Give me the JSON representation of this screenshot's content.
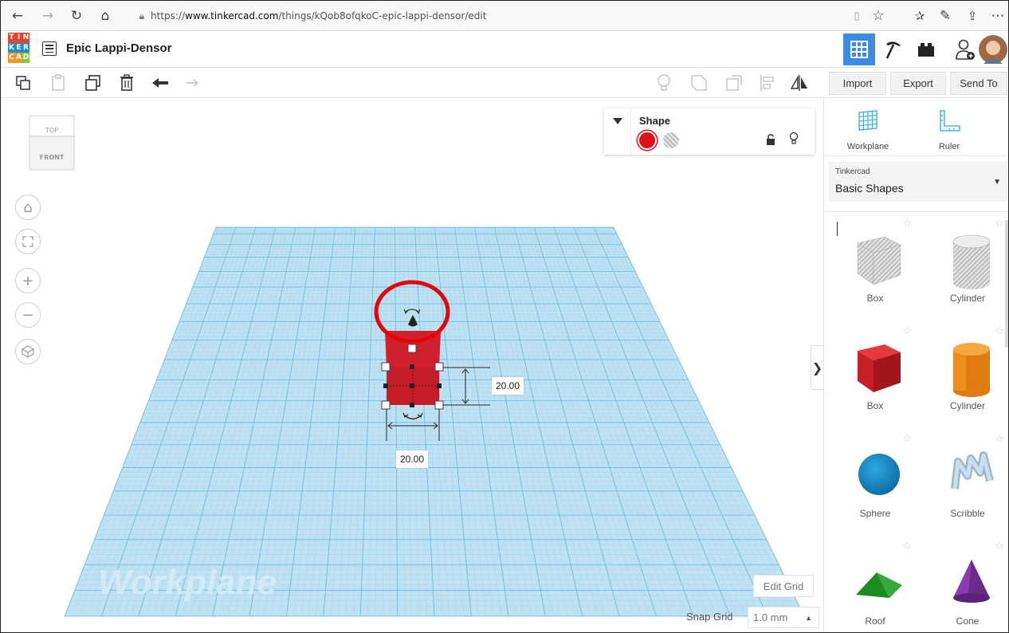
{
  "browser": {
    "url_prefix": "https://",
    "url_domain": "www.tinkercad.com",
    "url_path": "/things/kQob8ofqkoC-epic-lappi-densor/edit"
  },
  "app": {
    "logo_letters": [
      "T",
      "I",
      "N",
      "K",
      "E",
      "R",
      "C",
      "A",
      "D"
    ],
    "logo_colors": [
      "#e8412c",
      "#e8412c",
      "#e8412c",
      "#1d8fcf",
      "#1d8fcf",
      "#1d8fcf",
      "#ef9a1e",
      "#ef9a1e",
      "#8cc63e"
    ],
    "project_title": "Epic Lappi-Densor",
    "accent_color": "#3c8be6"
  },
  "toolbar": {
    "import_label": "Import",
    "export_label": "Export",
    "send_to_label": "Send To"
  },
  "viewcube": {
    "top_label": "TOP",
    "front_label": "FRONT"
  },
  "inspector": {
    "title": "Shape",
    "solid_color": "#e0101c"
  },
  "workplane": {
    "watermark": "Workplane",
    "width_dim": "20.00",
    "height_dim": "20.00",
    "edit_grid_label": "Edit Grid",
    "snap_grid_label": "Snap Grid",
    "snap_grid_value": "1.0 mm"
  },
  "right_panel": {
    "workplane_label": "Workplane",
    "ruler_label": "Ruler",
    "library_category": "Tinkercad",
    "library_name": "Basic Shapes",
    "shapes": [
      {
        "label": "Box",
        "icon": "hole-box-icon"
      },
      {
        "label": "Cylinder",
        "icon": "hole-cylinder-icon"
      },
      {
        "label": "Box",
        "icon": "red-box-icon"
      },
      {
        "label": "Cylinder",
        "icon": "orange-cylinder-icon"
      },
      {
        "label": "Sphere",
        "icon": "sphere-icon"
      },
      {
        "label": "Scribble",
        "icon": "scribble-icon"
      },
      {
        "label": "Roof",
        "icon": "roof-icon"
      },
      {
        "label": "Cone",
        "icon": "cone-icon"
      }
    ]
  },
  "annotation": {
    "highlight_color": "#e8000b"
  }
}
